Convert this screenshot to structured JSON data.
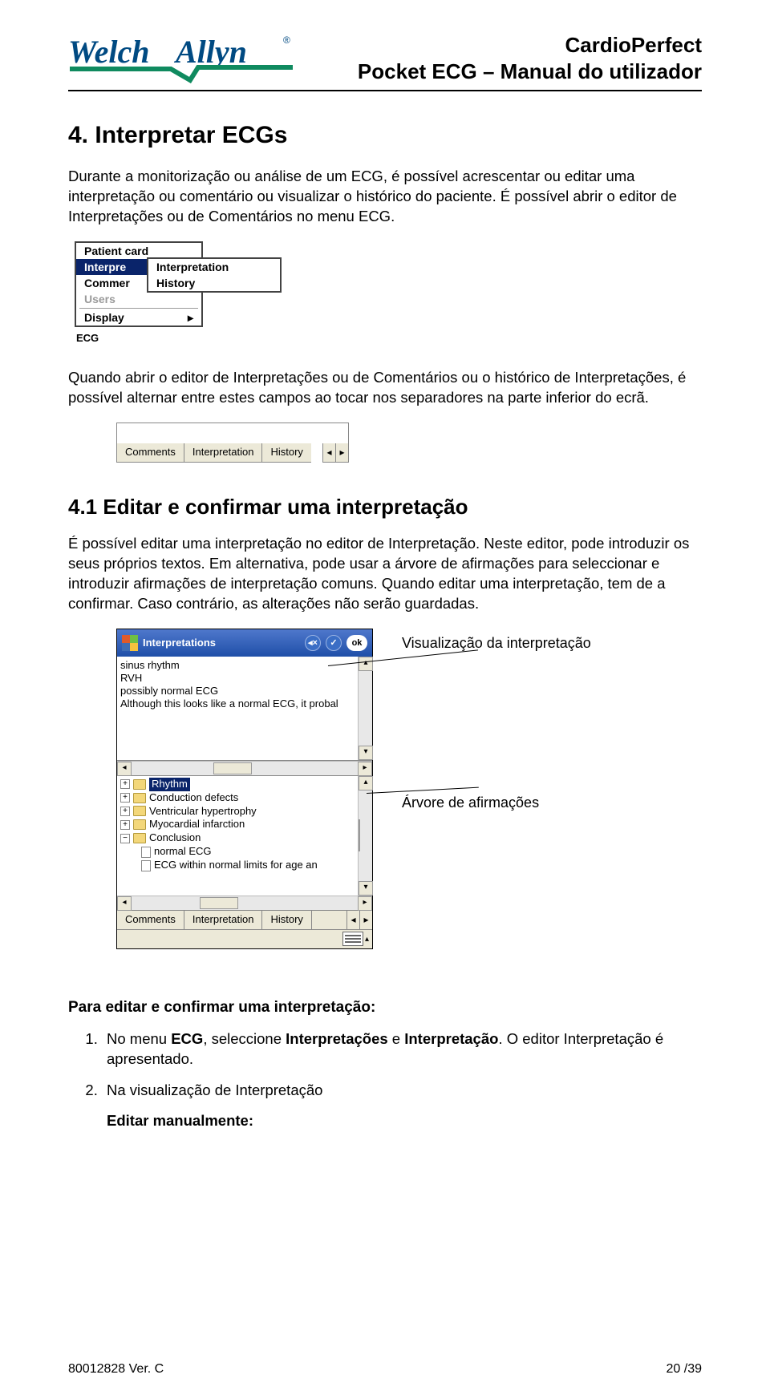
{
  "header": {
    "logo_text": "WelchAllyn",
    "title1": "CardioPerfect",
    "title2": "Pocket ECG – Manual do utilizador"
  },
  "section4": {
    "number_title": "4.    Interpretar ECGs",
    "p1": "Durante a monitorização ou análise de um ECG, é possível acrescentar ou editar uma interpretação ou comentário ou visualizar o histórico do paciente. É possível abrir o editor de Interpretações ou de Comentários no menu ECG.",
    "p2": "Quando abrir o editor de Interpretações ou de Comentários ou o histórico de Interpretações, é possível alternar entre estes campos ao tocar nos separadores na parte inferior do ecrã."
  },
  "menu1": {
    "item1": "Patient card",
    "item2": "Interpre",
    "item3": "Commer",
    "item4": "Users",
    "item5": "Display",
    "label": "ECG",
    "submenu": {
      "s1": "Interpretation",
      "s2": "History"
    },
    "arrow": "▸"
  },
  "tabs1": {
    "t1": "Comments",
    "t2": "Interpretation",
    "t3": "History",
    "left": "◂",
    "right": "▸"
  },
  "section41": {
    "title": "4.1    Editar e confirmar uma interpretação",
    "p1": "É possível editar uma interpretação no editor de Interpretação. Neste editor, pode introduzir os seus próprios textos. Em alternativa, pode usar a árvore de afirmações para seleccionar e introduzir afirmações de interpretação comuns. Quando editar uma interpretação, tem de a confirmar. Caso contrário, as alterações não serão guardadas."
  },
  "interp_win": {
    "title": "Interpretations",
    "mute": "◂×",
    "ok_check": "✓",
    "ok": "ok",
    "text_lines": {
      "l1": "sinus rhythm",
      "l2": "RVH",
      "l3": "possibly normal ECG",
      "l4": "Although this looks like a normal ECG, it probal"
    },
    "tree": {
      "n1": "Rhythm",
      "n2": "Conduction defects",
      "n3": "Ventricular hypertrophy",
      "n4": "Myocardial infarction",
      "n5": "Conclusion",
      "n5a": "normal ECG",
      "n5b": "ECG within normal limits for age an"
    },
    "btab1": "Comments",
    "btab2": "Interpretation",
    "btab3": "History",
    "left": "◂",
    "right": "▸",
    "up": "▴",
    "down": "▾",
    "plus": "+",
    "minus": "−"
  },
  "callouts": {
    "c1": "Visualização da interpretação",
    "c2": "Árvore de afirmações"
  },
  "steps_section": {
    "heading": "Para editar e confirmar uma interpretação:",
    "s1_pre": "No menu ",
    "s1_b1": "ECG",
    "s1_mid": ", seleccione ",
    "s1_b2": "Interpretações",
    "s1_mid2": " e ",
    "s1_b3": "Interpretação",
    "s1_post": ". O editor Interpretação é apresentado.",
    "s2": "Na visualização de Interpretação",
    "s2b": "Editar manualmente:"
  },
  "footer": {
    "left": "80012828 Ver. C",
    "right": "20  /39"
  }
}
